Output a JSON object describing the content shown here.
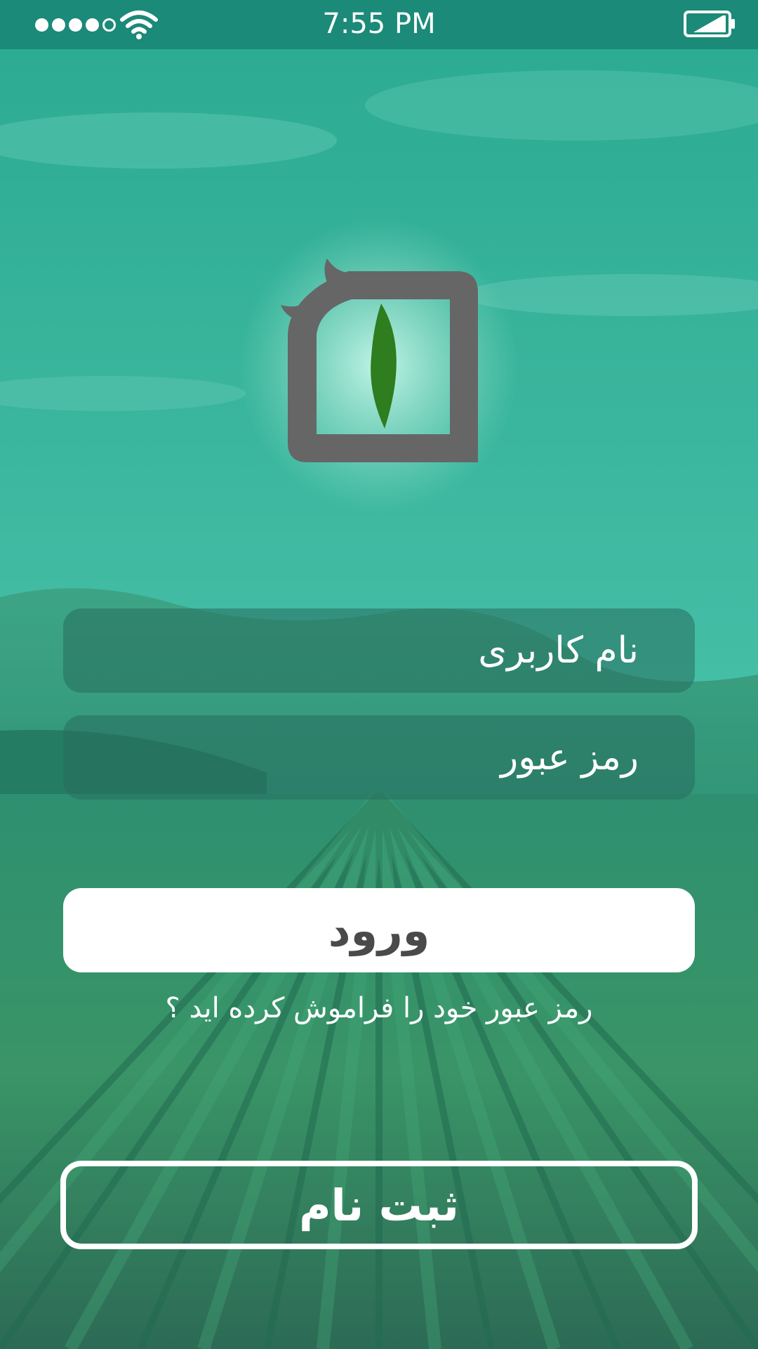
{
  "status_bar": {
    "time": "7:55 PM",
    "signal_icon": "signal-dots-icon",
    "wifi_icon": "wifi-icon",
    "battery_icon": "battery-icon"
  },
  "logo": {
    "icon": "leaf-logo-icon",
    "leaf_color": "#2e7d1e",
    "frame_color": "#666666"
  },
  "form": {
    "username_placeholder": "نام کاربری",
    "password_placeholder": "رمز عبور",
    "login_label": "ورود",
    "forgot_label": "رمز عبور خود را فراموش کرده اید ؟",
    "register_label": "ثبت نام"
  },
  "colors": {
    "status_bar": "#1b8a78",
    "overlay": "#3fc2a8",
    "button_text": "#4a4a4a"
  }
}
